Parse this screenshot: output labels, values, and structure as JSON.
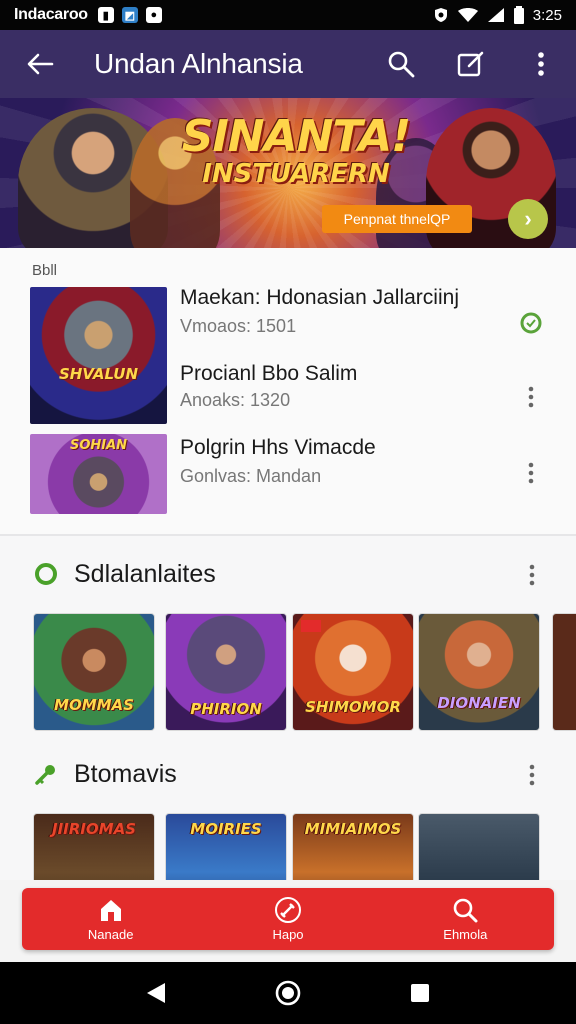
{
  "status_bar": {
    "carrier": "Indacaroo",
    "time": "3:25",
    "icons": [
      "sim-icon",
      "photo-icon",
      "record-icon",
      "shield-icon",
      "wifi-icon",
      "signal-icon",
      "battery-icon"
    ]
  },
  "app_bar": {
    "title": "Undan Alnhansia",
    "actions": [
      "search-icon",
      "edit-icon",
      "more-vert-icon"
    ]
  },
  "banner": {
    "headline_line1": "SINANTA!",
    "headline_line2": "INSTUARERN",
    "cta_label": "Penpnat thnelQP"
  },
  "list_section": {
    "label": "Bbll",
    "items": [
      {
        "title": "Maekan: Hdonasian Jallarciinj",
        "subtitle": "Vmoaos: 1501",
        "indicator": "check"
      },
      {
        "title": "Procianl Bbo Salim",
        "subtitle": "Anoaks: 1320",
        "indicator": "more"
      },
      {
        "title": "Polgrin Hhs Vimacde",
        "subtitle": "Gonlvas: Mandan",
        "indicator": "more"
      }
    ],
    "thumb_labels": [
      "SHVALUN",
      "SOHIAN"
    ]
  },
  "section_one": {
    "label": "Sdlalanlaites",
    "tiles": [
      "MOMMAS",
      "PHIRION",
      "SHIMOMOR",
      "DIONAIEN"
    ]
  },
  "section_two": {
    "label": "Btomavis",
    "tiles": [
      "JIIRIOMAS",
      "MOIRIES",
      "MIMIAIMOS",
      ""
    ]
  },
  "bottom_nav": {
    "items": [
      {
        "label": "Nanade",
        "icon": "home-icon"
      },
      {
        "label": "Hapo",
        "icon": "sword-icon"
      },
      {
        "label": "Ehmola",
        "icon": "search-icon"
      }
    ]
  },
  "colors": {
    "app_bar": "#3a2e64",
    "accent_red": "#e32b2b",
    "check_green": "#5aa33a",
    "cta_orange": "#f28a12"
  }
}
